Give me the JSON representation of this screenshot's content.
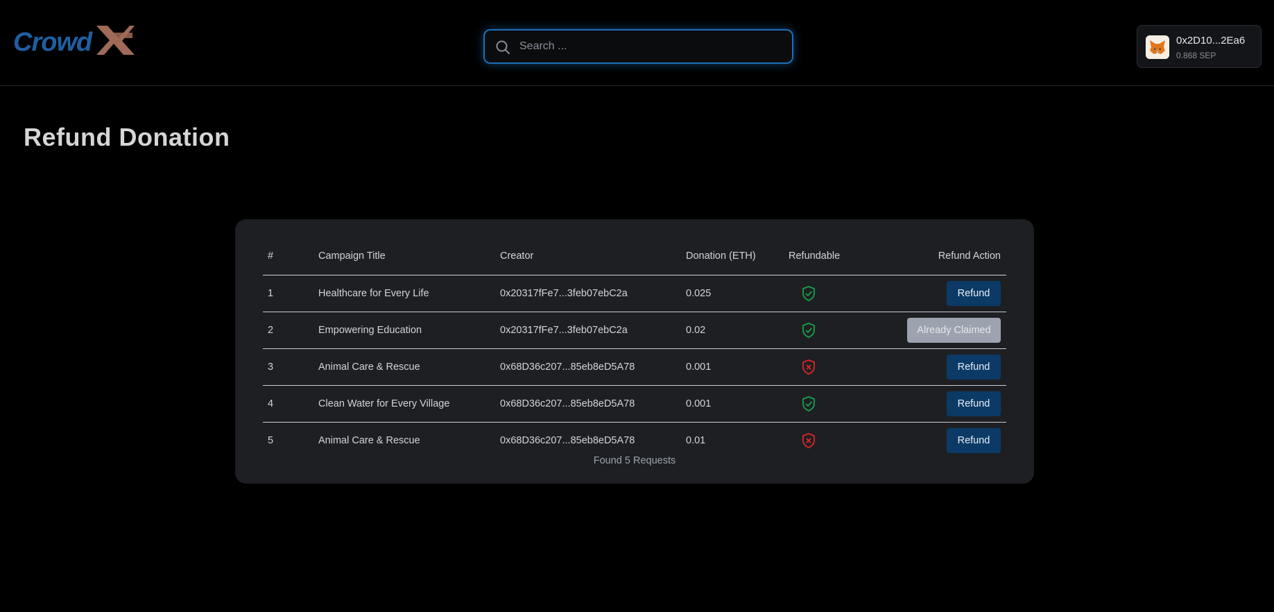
{
  "header": {
    "logo_text": "CrowdX",
    "search": {
      "placeholder": "Search ...",
      "value": ""
    },
    "wallet": {
      "address": "0x2D10...2Ea6",
      "balance": "0.868 SEP"
    }
  },
  "page": {
    "title": "Refund Donation"
  },
  "table": {
    "columns": [
      "#",
      "Campaign Title",
      "Creator",
      "Donation (ETH)",
      "Refundable",
      "Refund Action"
    ],
    "rows": [
      {
        "num": "1",
        "title": "Healthcare for Every Life",
        "creator": "0x20317fFe7...3feb07ebC2a",
        "donation": "0.025",
        "refundable": true,
        "action": "Refund",
        "claimed": false
      },
      {
        "num": "2",
        "title": "Empowering Education",
        "creator": "0x20317fFe7...3feb07ebC2a",
        "donation": "0.02",
        "refundable": true,
        "action": "Already Claimed",
        "claimed": true
      },
      {
        "num": "3",
        "title": "Animal Care & Rescue",
        "creator": "0x68D36c207...85eb8eD5A78",
        "donation": "0.001",
        "refundable": false,
        "action": "Refund",
        "claimed": false
      },
      {
        "num": "4",
        "title": "Clean Water for Every Village",
        "creator": "0x68D36c207...85eb8eD5A78",
        "donation": "0.001",
        "refundable": true,
        "action": "Refund",
        "claimed": false
      },
      {
        "num": "5",
        "title": "Animal Care & Rescue",
        "creator": "0x68D36c207...85eb8eD5A78",
        "donation": "0.01",
        "refundable": false,
        "action": "Refund",
        "claimed": false
      }
    ],
    "footer": "Found 5 Requests"
  },
  "colors": {
    "accent": "#1d6fb8",
    "refund_button": "#0b3a66",
    "claimed_button": "#9ca3af",
    "refundable_yes": "#16a34a",
    "refundable_no": "#dc2626",
    "logo_blue": "#1e5fa0",
    "logo_brown": "#a06a58"
  },
  "icons": {
    "search": "search-icon",
    "wallet": "metamask-fox-icon",
    "refundable_yes": "shield-check-icon",
    "refundable_no": "shield-x-icon"
  }
}
